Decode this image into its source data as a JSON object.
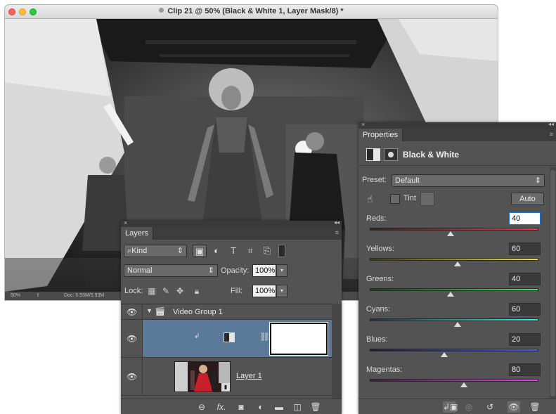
{
  "document": {
    "title": "Clip 21 @ 50% (Black & White 1, Layer Mask/8) *",
    "status_zoom": "50%",
    "status_doc": "Doc: 5.93M/5.93M"
  },
  "layers_panel": {
    "tab": "Layers",
    "kind_filter": "Kind",
    "blend_mode": "Normal",
    "opacity_label": "Opacity:",
    "opacity_value": "100%",
    "lock_label": "Lock:",
    "fill_label": "Fill:",
    "fill_value": "100%",
    "layers": [
      {
        "name": "Video Group 1",
        "type": "group",
        "visible": true
      },
      {
        "name": "",
        "type": "adjustment-black-white",
        "visible": true,
        "selected": true
      },
      {
        "name": "Layer 1",
        "type": "video",
        "visible": true
      }
    ],
    "footer_icons": [
      "link-icon",
      "fx-icon",
      "add-mask-icon",
      "new-adjustment-icon",
      "new-group-icon",
      "new-layer-icon",
      "trash-icon"
    ]
  },
  "properties_panel": {
    "tab": "Properties",
    "title": "Black & White",
    "preset_label": "Preset:",
    "preset_value": "Default",
    "tint_label": "Tint",
    "tint_checked": false,
    "auto_label": "Auto",
    "sliders": [
      {
        "label": "Reds:",
        "value": "40",
        "colors": [
          "#3a1d1d",
          "#e84040"
        ]
      },
      {
        "label": "Yellows:",
        "value": "60",
        "colors": [
          "#3a3a1d",
          "#e8e040"
        ]
      },
      {
        "label": "Greens:",
        "value": "40",
        "colors": [
          "#1d3a1d",
          "#40e860"
        ]
      },
      {
        "label": "Cyans:",
        "value": "60",
        "colors": [
          "#1d3a3a",
          "#40e8e8"
        ]
      },
      {
        "label": "Blues:",
        "value": "20",
        "colors": [
          "#1d1d3a",
          "#4060e8"
        ]
      },
      {
        "label": "Magentas:",
        "value": "80",
        "colors": [
          "#3a1d3a",
          "#e040e8"
        ]
      }
    ],
    "footer_icons": [
      "clip-to-layer-icon",
      "view-previous-icon",
      "reset-icon",
      "visibility-icon",
      "trash-icon"
    ]
  }
}
